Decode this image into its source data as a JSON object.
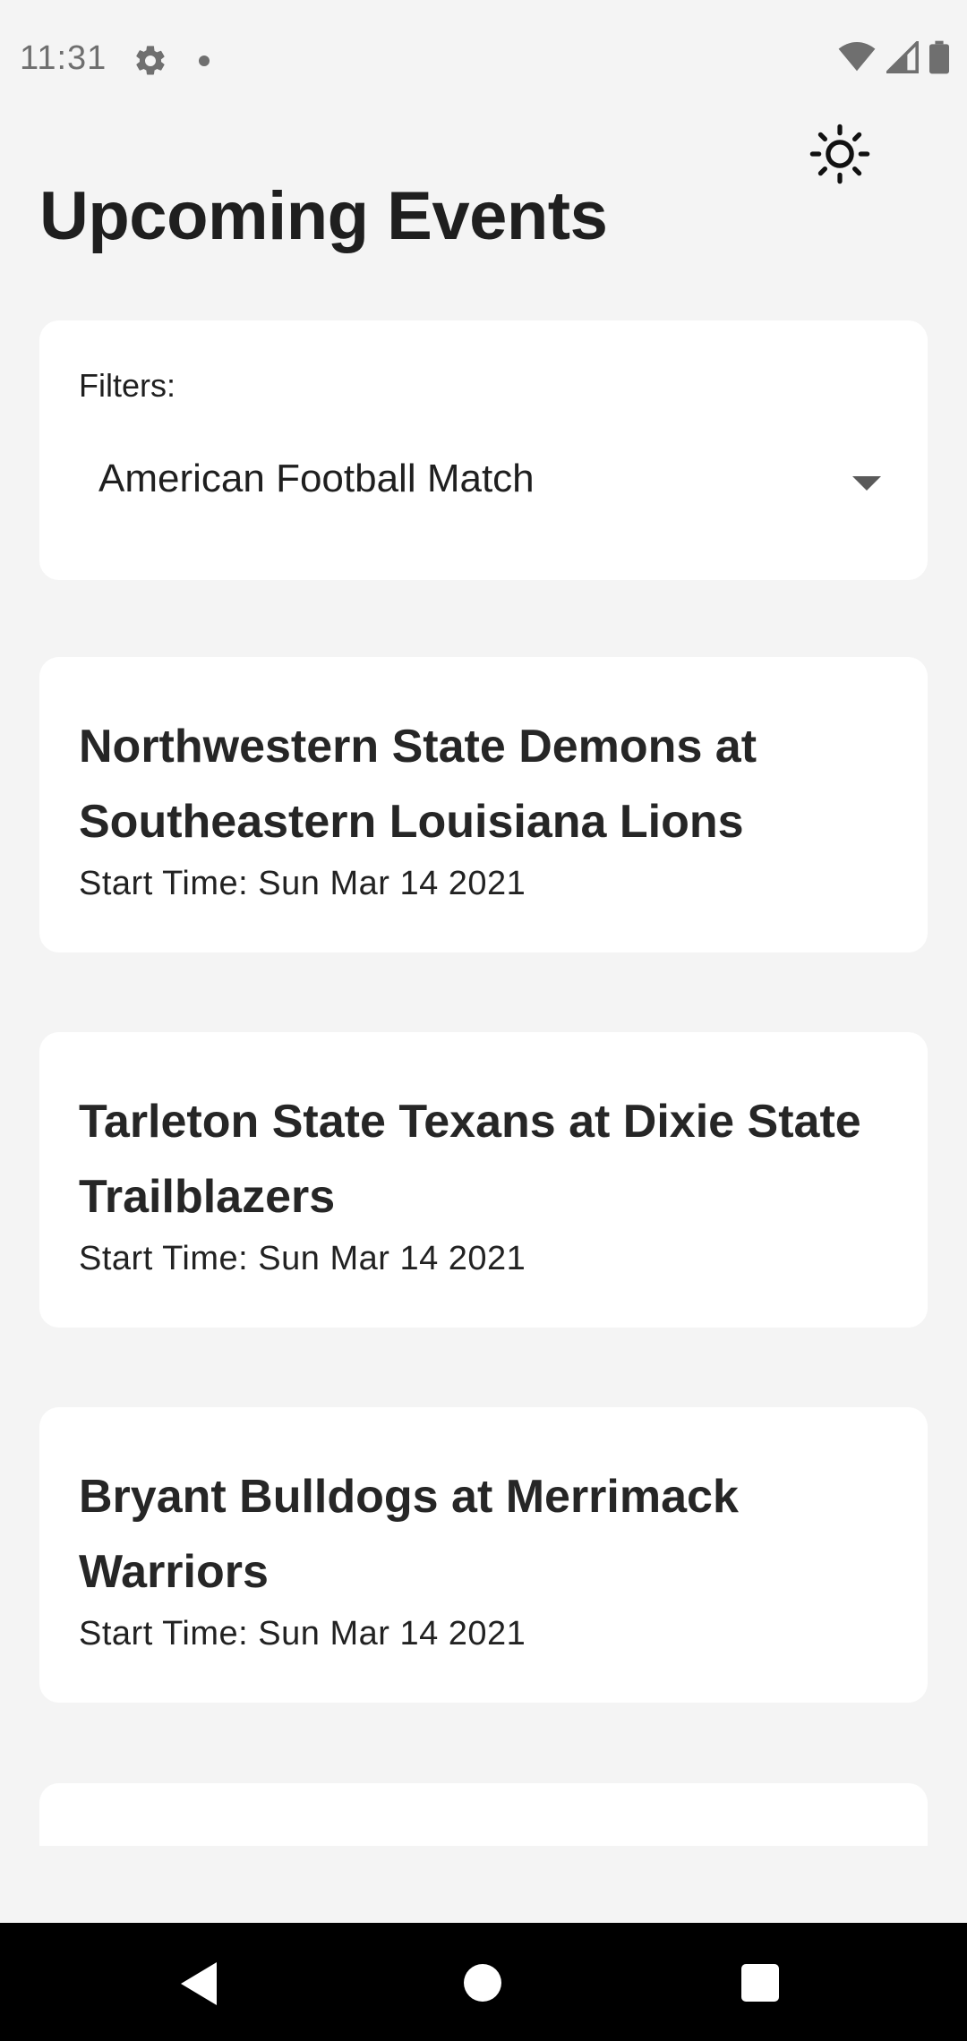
{
  "status_bar": {
    "time": "11:31",
    "icons": [
      "settings-gear-icon",
      "notification-dot-icon",
      "wifi-icon",
      "cell-signal-icon",
      "battery-icon"
    ]
  },
  "header": {
    "title": "Upcoming Events",
    "theme_toggle_icon": "sun-icon"
  },
  "filters": {
    "label": "Filters:",
    "selected": "American Football Match"
  },
  "events": [
    {
      "title": "Northwestern State Demons at Southeastern Louisiana Lions",
      "start_time": "Start Time: Sun Mar 14 2021"
    },
    {
      "title": "Tarleton State Texans at Dixie State Trailblazers",
      "start_time": "Start Time: Sun Mar 14 2021"
    },
    {
      "title": "Bryant Bulldogs at Merrimack Warriors",
      "start_time": "Start Time: Sun Mar 14 2021"
    }
  ],
  "nav_bar": {
    "icons": [
      "back-icon",
      "home-icon",
      "recents-icon"
    ]
  },
  "colors": {
    "background": "#f4f4f4",
    "card": "#ffffff",
    "text": "#1f1f1f",
    "nav_bar": "#000000"
  }
}
